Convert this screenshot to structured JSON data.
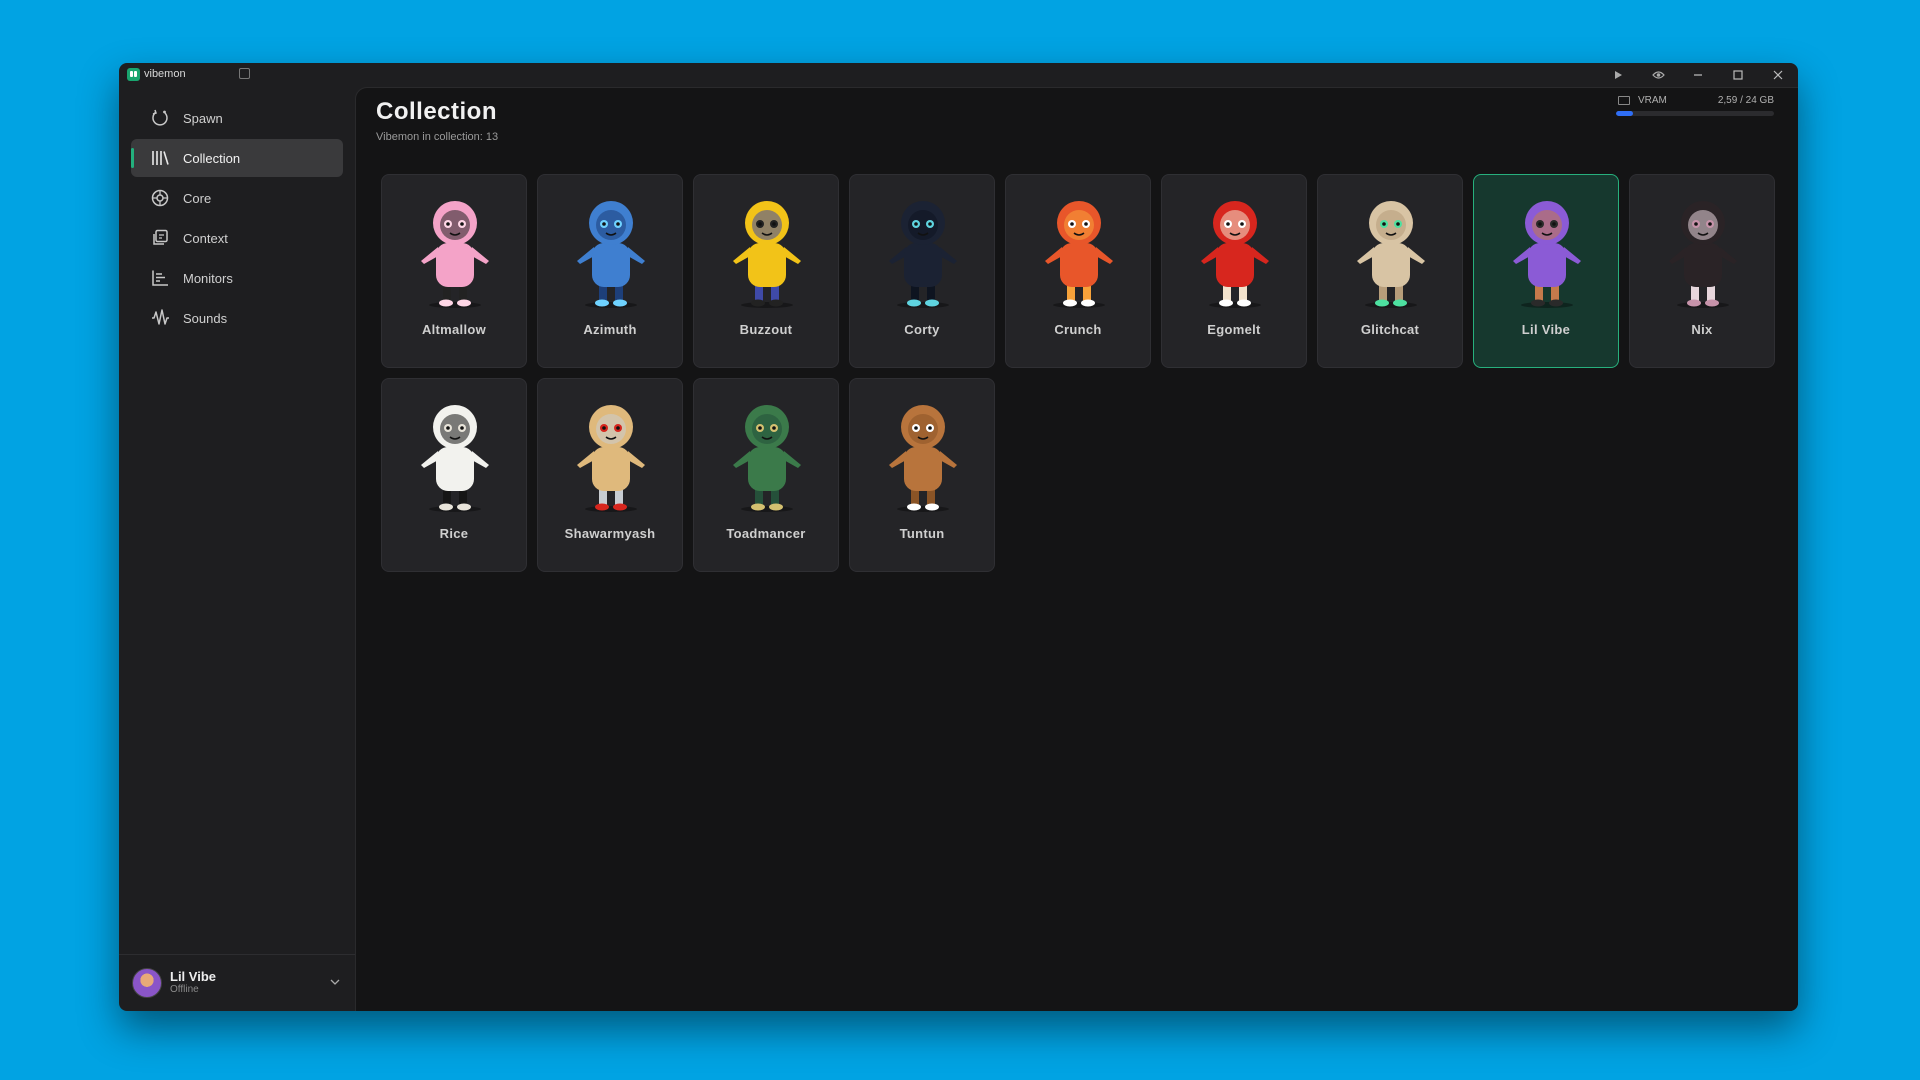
{
  "app": {
    "name": "vibemon"
  },
  "sidebar": {
    "items": [
      {
        "label": "Spawn",
        "icon": "spawn-icon",
        "active": false
      },
      {
        "label": "Collection",
        "icon": "library-icon",
        "active": true
      },
      {
        "label": "Core",
        "icon": "core-icon",
        "active": false
      },
      {
        "label": "Context",
        "icon": "context-icon",
        "active": false
      },
      {
        "label": "Monitors",
        "icon": "monitors-icon",
        "active": false
      },
      {
        "label": "Sounds",
        "icon": "sounds-icon",
        "active": false
      }
    ]
  },
  "profile": {
    "name": "Lil Vibe",
    "status": "Offline"
  },
  "page": {
    "title": "Collection",
    "subtitle": "Vibemon in collection: 13"
  },
  "vram": {
    "label": "VRAM",
    "value": "2,59 / 24 GB",
    "used_fraction": 0.108
  },
  "colors": {
    "accent": "#27b07d",
    "vram_bar": "#2f6ef5",
    "background": "#01a3e3"
  },
  "collection": [
    {
      "name": "Altmallow",
      "colors": [
        "#f4a3c8",
        "#222",
        "#ffd6e6"
      ]
    },
    {
      "name": "Azimuth",
      "colors": [
        "#3f7fd0",
        "#1d3f7a",
        "#6fd2ff"
      ]
    },
    {
      "name": "Buzzout",
      "colors": [
        "#f2c318",
        "#3f4aa8",
        "#222"
      ]
    },
    {
      "name": "Corty",
      "colors": [
        "#1b2233",
        "#0e1420",
        "#5fd4e0"
      ]
    },
    {
      "name": "Crunch",
      "colors": [
        "#e8562a",
        "#f7a23a",
        "#fff"
      ]
    },
    {
      "name": "Egomelt",
      "colors": [
        "#d7261e",
        "#f2e2cc",
        "#fff"
      ]
    },
    {
      "name": "Glitchcat",
      "colors": [
        "#d8c4a4",
        "#b79d7a",
        "#4de0a0"
      ]
    },
    {
      "name": "Lil Vibe",
      "colors": [
        "#8b5bd6",
        "#c57a4b",
        "#2a2a2a"
      ],
      "selected": true
    },
    {
      "name": "Nix",
      "colors": [
        "#2a2326",
        "#e7d6dc",
        "#c793aa"
      ]
    },
    {
      "name": "Rice",
      "colors": [
        "#f2f2ee",
        "#161616",
        "#e8e4da"
      ]
    },
    {
      "name": "Shawarmyash",
      "colors": [
        "#dfb97c",
        "#c8cdd2",
        "#d7261e"
      ]
    },
    {
      "name": "Toadmancer",
      "colors": [
        "#3b7a4a",
        "#25503a",
        "#d4c070"
      ]
    },
    {
      "name": "Tuntun",
      "colors": [
        "#b8743c",
        "#8a5426",
        "#fff"
      ]
    }
  ]
}
